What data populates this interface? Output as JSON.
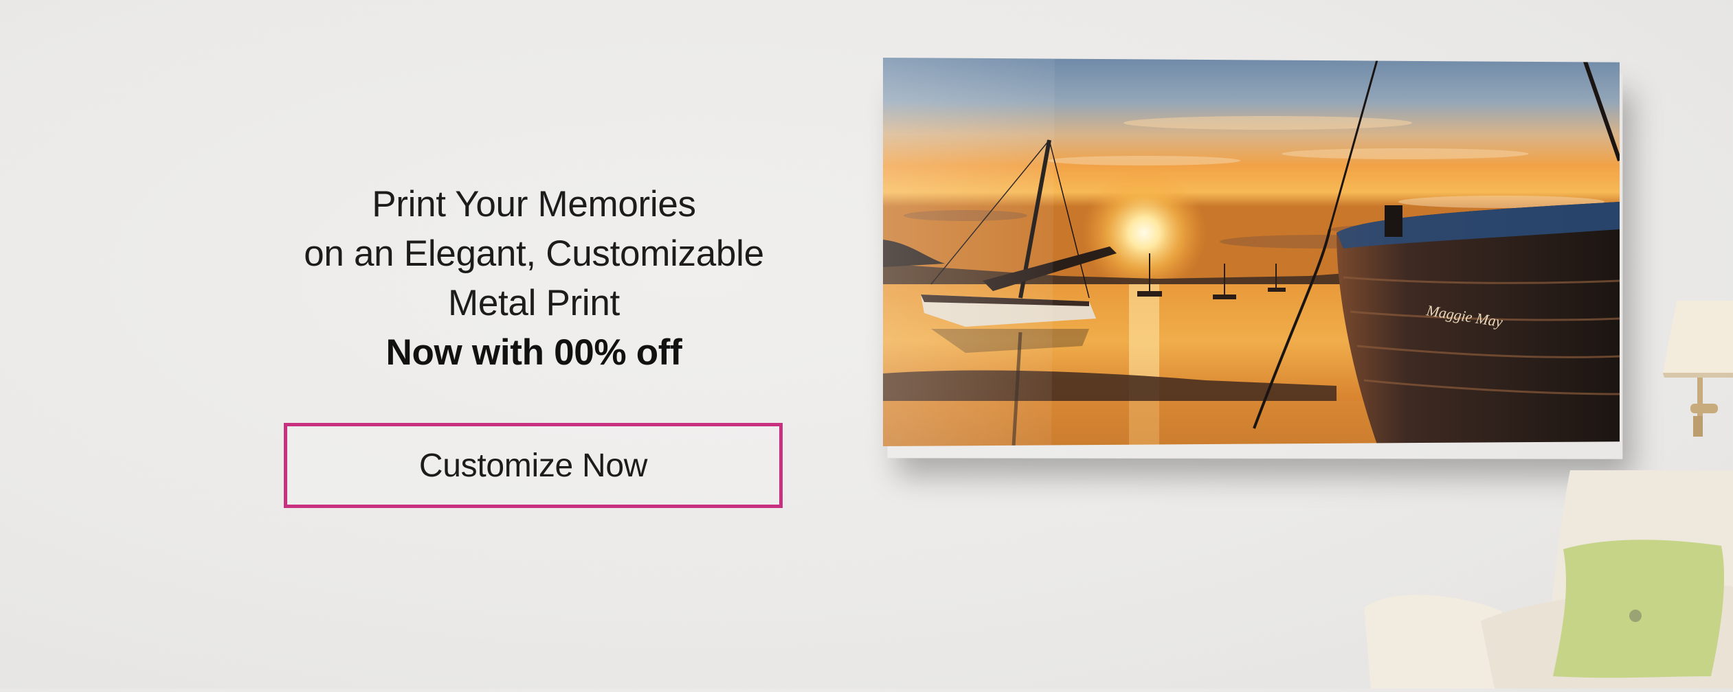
{
  "hero": {
    "headline_line1": "Print Your Memories",
    "headline_line2": "on an Elegant, Customizable",
    "headline_line3": "Metal Print",
    "offer": "Now with 00% off",
    "cta_label": "Customize Now"
  },
  "print": {
    "boat_name": "Maggie May"
  },
  "colors": {
    "accent": "#c8317f",
    "text": "#1c1c1c",
    "background": "#ebeae8"
  }
}
